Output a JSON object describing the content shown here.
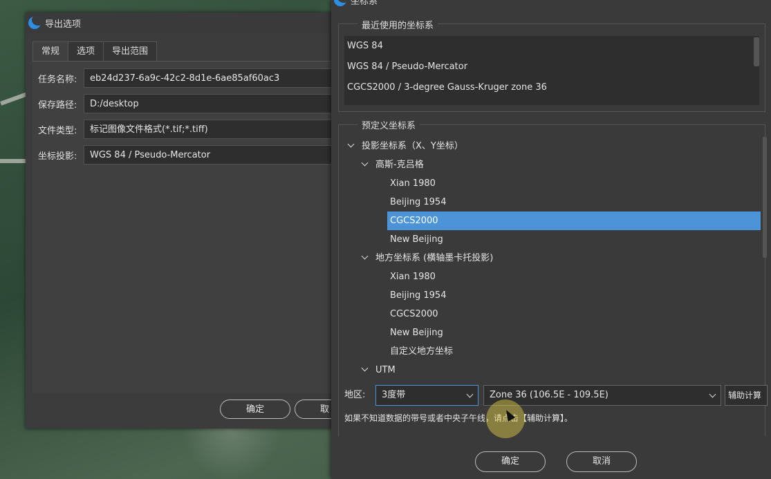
{
  "export_dialog": {
    "title": "导出选项",
    "tabs": [
      "常规",
      "选项",
      "导出范围"
    ],
    "fields": [
      {
        "label": "任务名称:",
        "value": "eb24d237-6a9c-42c2-8d1e-6ae85af60ac3"
      },
      {
        "label": "保存路径:",
        "value": "D:/desktop"
      },
      {
        "label": "文件类型:",
        "value": "标记图像文件格式(*.tif;*.tiff)"
      },
      {
        "label": "坐标投影:",
        "value": "WGS 84 / Pseudo-Mercator"
      }
    ],
    "ok_label": "确定",
    "cancel_label": "取"
  },
  "crs_dialog": {
    "title": "坐标系",
    "recent_title": "最近使用的坐标系",
    "recent_items": [
      "WGS 84",
      "WGS 84 / Pseudo-Mercator",
      "CGCS2000 / 3-degree Gauss-Kruger zone 36"
    ],
    "predefined_title": "预定义坐标系",
    "tree": {
      "projected": "投影坐标系（X、Y坐标）",
      "gauss": "高斯-克吕格",
      "gauss_items": [
        "Xian 1980",
        "Beijing 1954",
        "CGCS2000",
        "New Beijing"
      ],
      "local": "地方坐标系 (横轴墨卡托投影)",
      "local_items": [
        "Xian 1980",
        "Beijing 1954",
        "CGCS2000",
        "New Beijing",
        "自定义地方坐标"
      ],
      "utm": "UTM",
      "selected": "CGCS2000"
    },
    "region_label": "地区:",
    "band_value": "3度带",
    "zone_value": "Zone 36 (106.5E - 109.5E)",
    "assist_label": "辅助计算",
    "hint": "如果不知道数据的带号或者中央子午线，请点击【辅助计算】。",
    "ok_label": "确定",
    "cancel_label": "取消"
  },
  "colors": {
    "selection": "#4c93d8",
    "dialog_bg": "#3a3a3a"
  }
}
